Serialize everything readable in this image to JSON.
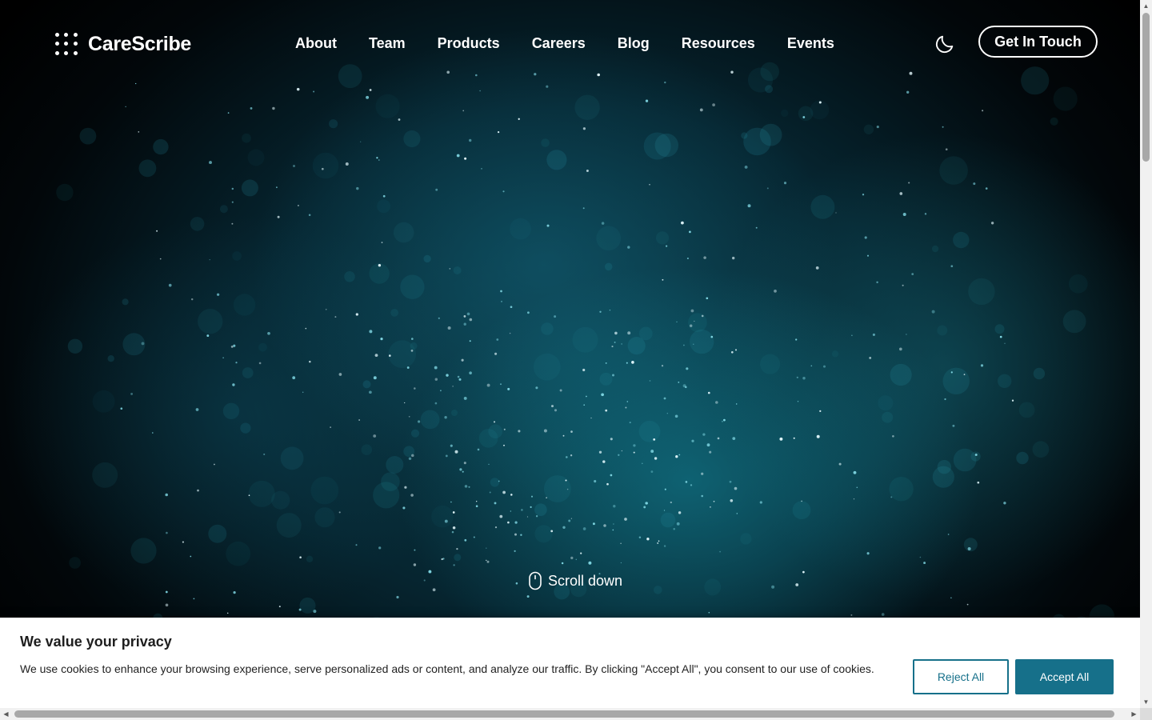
{
  "brand": {
    "name": "CareScribe"
  },
  "nav": {
    "items": [
      "About",
      "Team",
      "Products",
      "Careers",
      "Blog",
      "Resources",
      "Events"
    ]
  },
  "header": {
    "theme_toggle_icon": "moon-icon",
    "cta_label": "Get In Touch"
  },
  "hero": {
    "scroll_label": "Scroll down",
    "scroll_icon": "mouse-icon"
  },
  "cookie_banner": {
    "title": "We value your privacy",
    "text": "We use cookies to enhance your browsing experience, serve personalized ads or content, and analyze our traffic. By clicking \"Accept All\", you consent to our use of cookies.",
    "reject_label": "Reject All",
    "accept_label": "Accept All"
  },
  "colors": {
    "accent": "#16708a",
    "hero_dark": "#02070a",
    "hero_teal": "#0b3b48"
  }
}
